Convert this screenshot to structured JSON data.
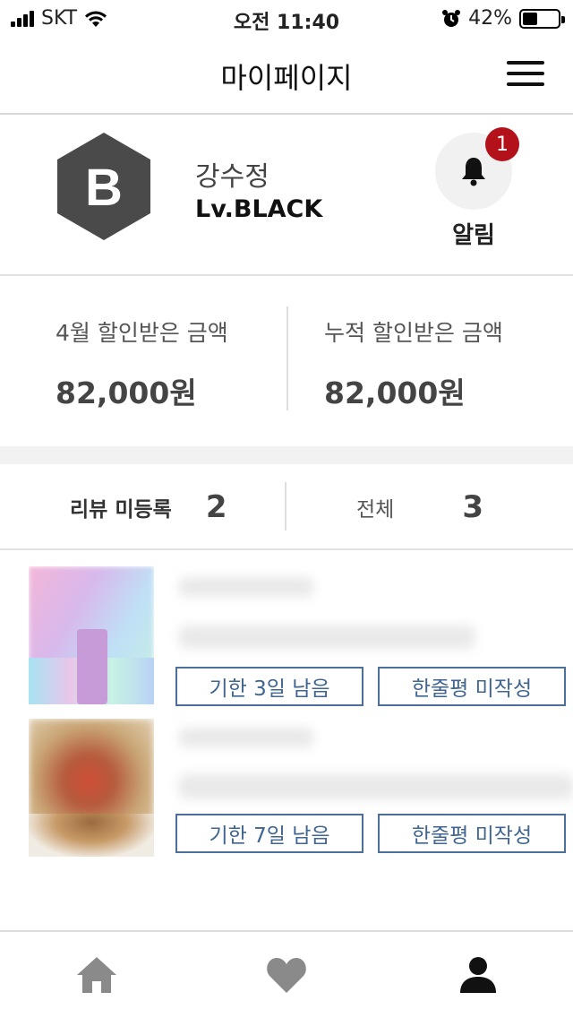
{
  "status_bar": {
    "carrier": "SKT",
    "time": "오전 11:40",
    "battery_percent": "42%",
    "battery_level": 0.42
  },
  "header": {
    "title": "마이페이지"
  },
  "profile": {
    "grade_letter": "B",
    "name": "강수정",
    "level": "Lv.BLACK",
    "alarm_count": "1",
    "alarm_label": "알림"
  },
  "discount": {
    "month_label": "4월 할인받은 금액",
    "month_value": "82,000원",
    "total_label": "누적 할인받은 금액",
    "total_value": "82,000원"
  },
  "review_tabs": {
    "unregistered_label": "리뷰 미등록",
    "unregistered_count": "2",
    "all_label": "전체",
    "all_count": "3"
  },
  "review_items": [
    {
      "deadline": "기한 3일 남음",
      "status": "한줄평 미작성"
    },
    {
      "deadline": "기한 7일 남음",
      "status": "한줄평 미작성"
    }
  ],
  "tab_bar": {
    "icons": [
      "home-icon",
      "heart-icon",
      "user-icon"
    ]
  },
  "colors": {
    "accent_blue": "#3f6590",
    "badge_red": "#b4121b",
    "grade_hex": "#4a4a4a"
  }
}
